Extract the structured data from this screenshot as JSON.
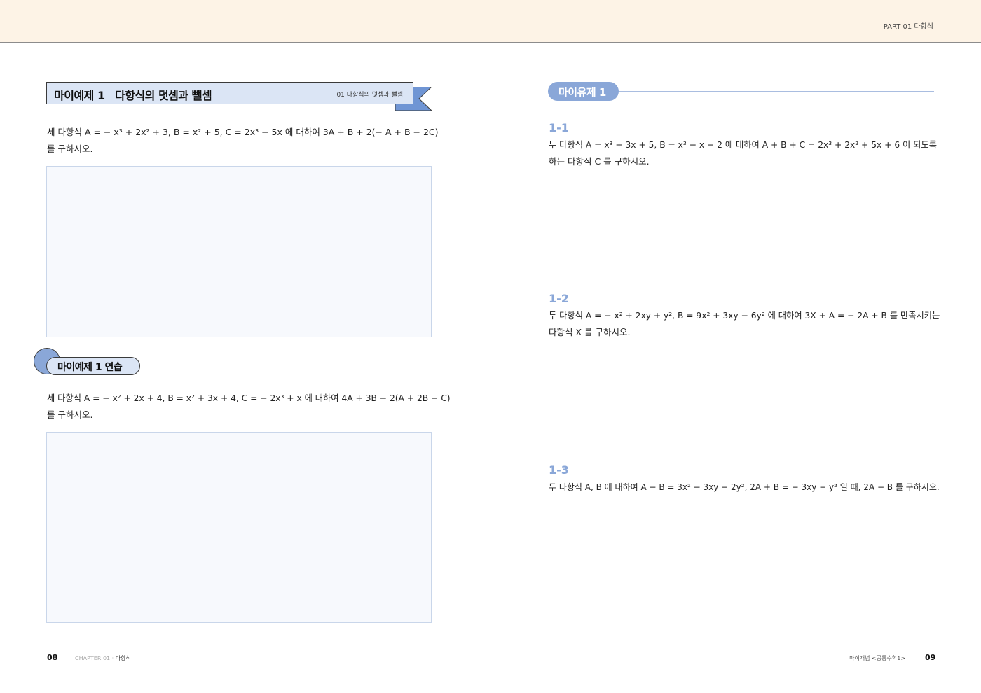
{
  "header": {
    "part_label": "PART 01 다항식"
  },
  "left_page": {
    "example": {
      "label": "마이예제 1",
      "title": "다항식의 덧셈과 뺄셈",
      "section_ref": "01 다항식의 덧셈과 뺄셈",
      "problem_line1": "세 다항식 A = − x³ + 2x² + 3, B = x² + 5, C = 2x³ − 5x 에 대하여 3A + B + 2(− A + B − 2C)",
      "problem_line2": "를 구하시오."
    },
    "practice": {
      "label": "마이예제 1 연습",
      "problem_line1": "세 다항식 A = − x² + 2x + 4, B = x² + 3x + 4, C = − 2x³ + x 에 대하여 4A + 3B − 2(A + 2B − C)",
      "problem_line2": "를 구하시오."
    },
    "footer": {
      "page_number": "08",
      "chapter": "CHAPTER 01 · ",
      "chapter_title": "다항식"
    }
  },
  "right_page": {
    "similar_label": "마이유제 1",
    "questions": [
      {
        "number": "1-1",
        "line1": "두 다항식 A = x³ + 3x + 5, B = x³ − x − 2 에 대하여 A + B + C = 2x³ + 2x² + 5x + 6 이 되도록",
        "line2": "하는 다항식 C 를 구하시오."
      },
      {
        "number": "1-2",
        "line1": "두 다항식 A = − x² + 2xy + y², B = 9x² + 3xy − 6y² 에 대하여 3X + A = − 2A + B 를 만족시키는",
        "line2": "다항식 X 를 구하시오."
      },
      {
        "number": "1-3",
        "line1": "두 다항식 A, B 에 대하여 A − B = 3x² − 3xy − 2y², 2A + B = − 3xy − y² 일 때, 2A − B 를 구하시오.",
        "line2": ""
      }
    ],
    "footer": {
      "book_title": "마이개념 <공통수학1>",
      "page_number": "09"
    }
  }
}
